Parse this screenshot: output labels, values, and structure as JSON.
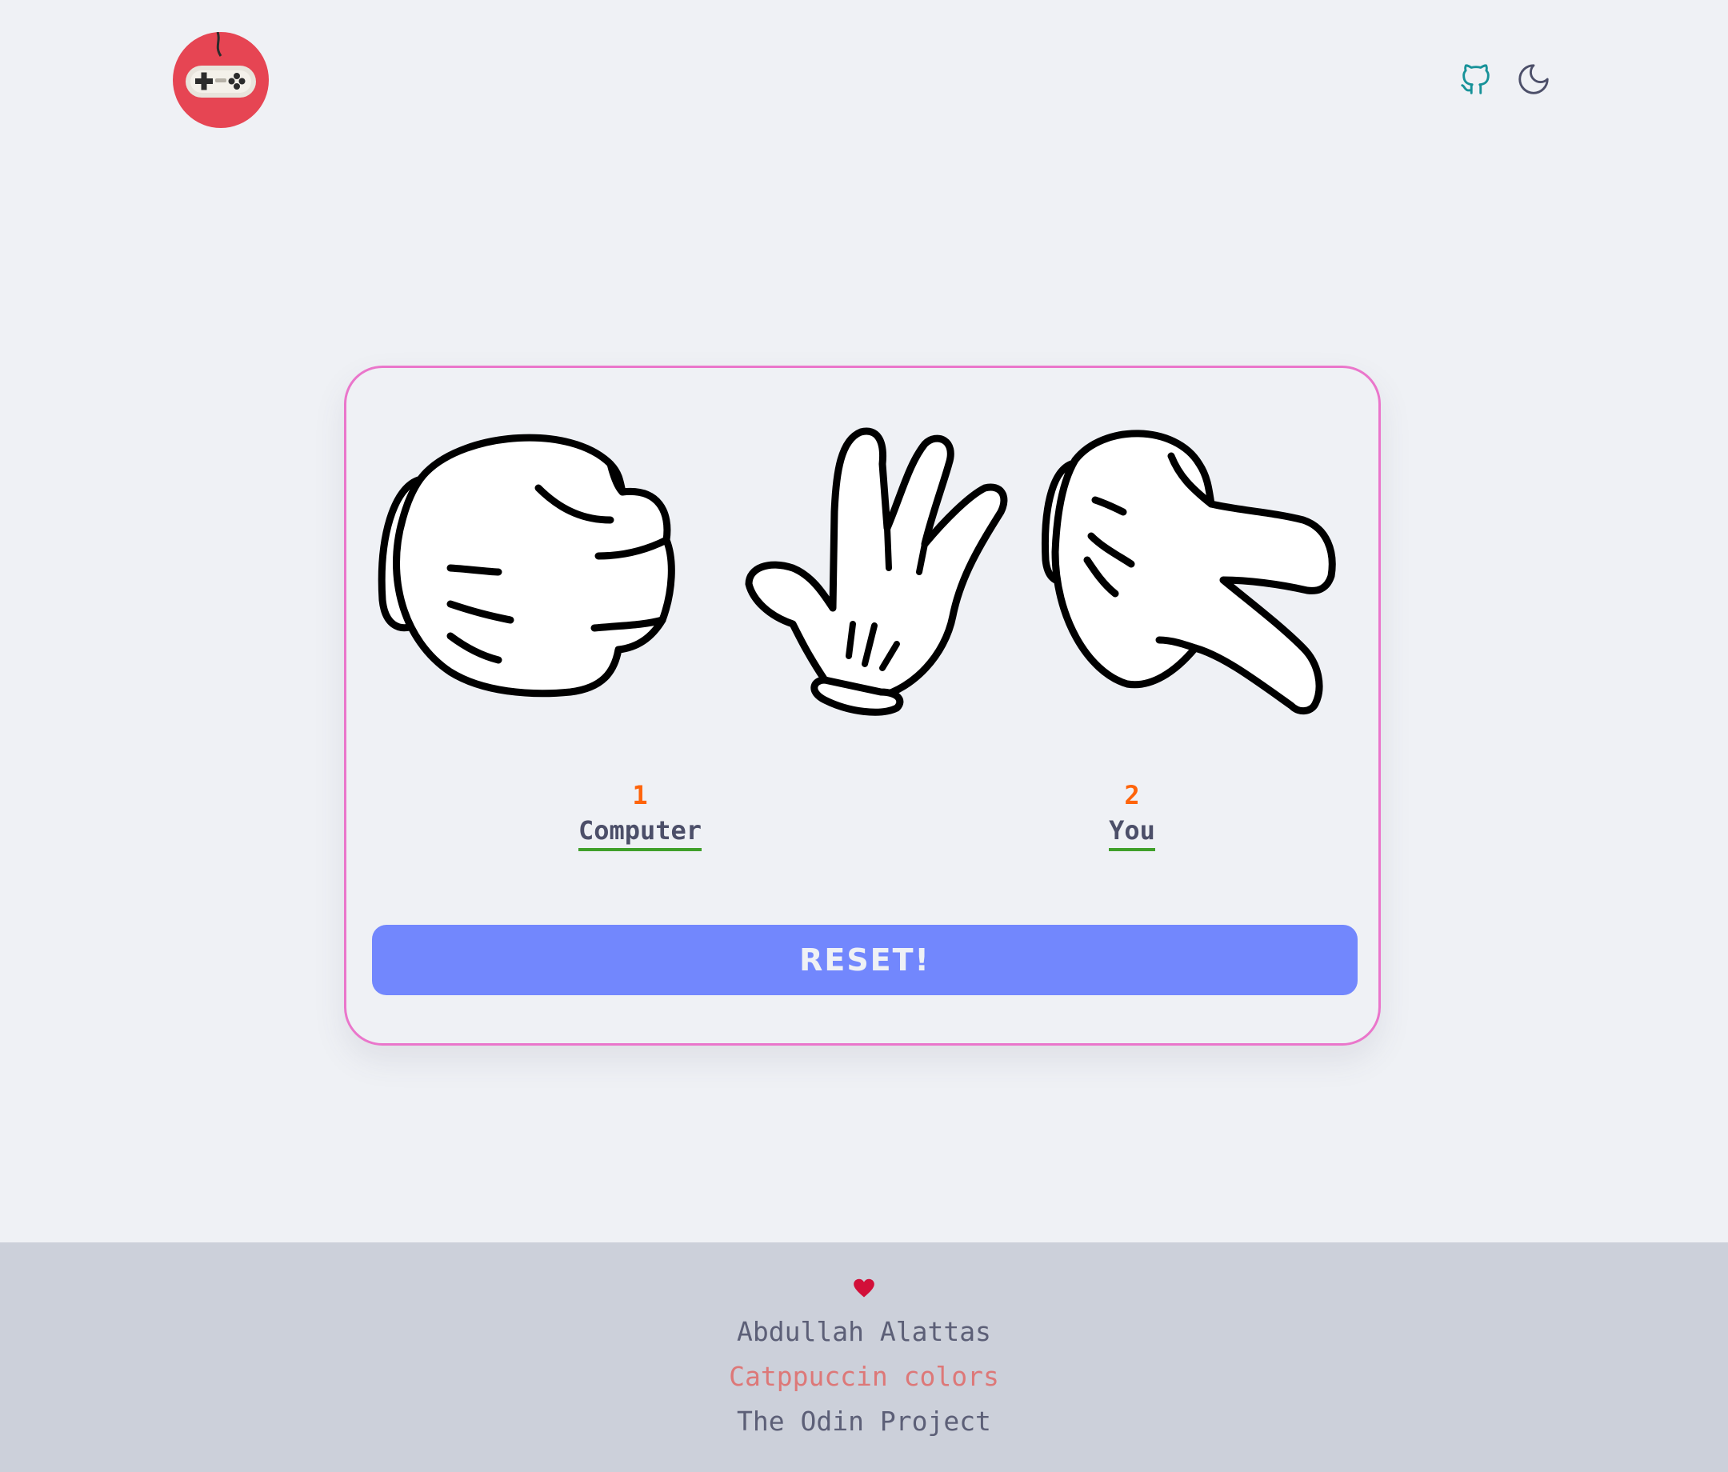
{
  "header": {
    "logo_icon": "gamepad-icon",
    "github_icon": "github-icon",
    "theme_icon": "moon-icon"
  },
  "game": {
    "choices": [
      "rock",
      "paper",
      "scissors"
    ],
    "computer": {
      "score": "1",
      "label": "Computer"
    },
    "you": {
      "score": "2",
      "label": "You"
    },
    "reset_label": "RESET!"
  },
  "footer": {
    "heart_icon": "heart-icon",
    "author": "Abdullah Alattas",
    "colors_credit": "Catppuccin colors",
    "odin": "The Odin Project"
  },
  "colors": {
    "background": "#eff1f5",
    "card_border": "#ea76cb",
    "score": "#fe640b",
    "name_underline": "#40a02b",
    "reset_button": "#7287fd",
    "footer_bg": "#ccd0da",
    "logo_bg": "#e64553",
    "github": "#179299",
    "colors_link": "#dd7878"
  }
}
